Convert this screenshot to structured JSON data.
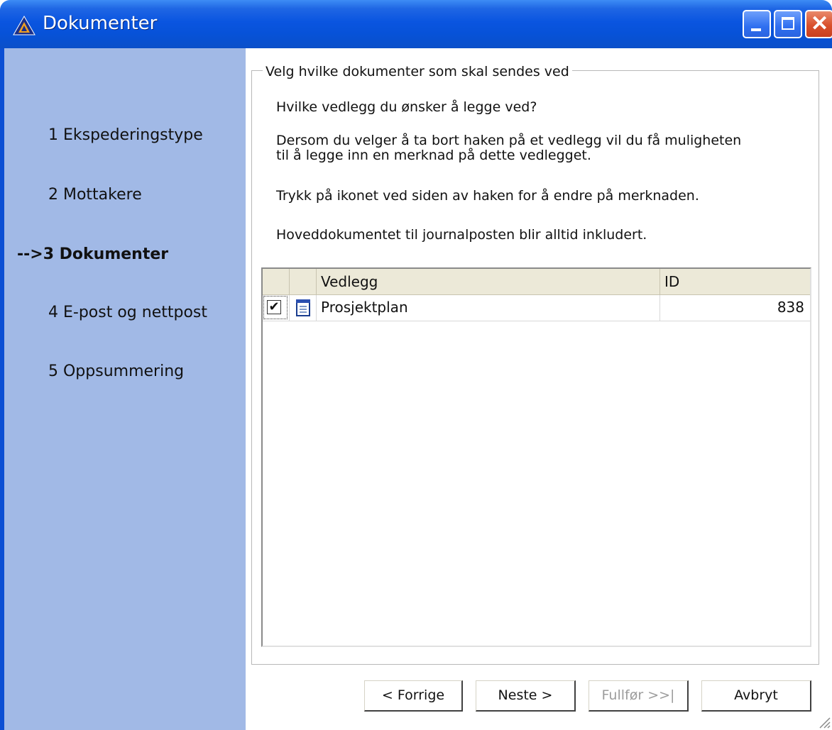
{
  "window": {
    "title": "Dokumenter"
  },
  "steps": [
    {
      "label": "1 Ekspederingstype",
      "active": false
    },
    {
      "label": "2 Mottakere",
      "active": false
    },
    {
      "label": "-->3 Dokumenter",
      "active": true
    },
    {
      "label": "4 E-post og nettpost",
      "active": false
    },
    {
      "label": "5 Oppsummering",
      "active": false
    }
  ],
  "group": {
    "legend": "Velg hvilke dokumenter som skal sendes ved",
    "question": "Hvilke vedlegg du ønsker å legge ved?",
    "info_line1": "Dersom du velger å ta bort haken på et vedlegg vil du få muligheten",
    "info_line2": "til å legge inn en merknad på dette vedlegget.",
    "info_icon": "Trykk på ikonet ved siden av haken for å endre på merknaden.",
    "info_main": "Hoveddokumentet til journalposten blir alltid inkludert."
  },
  "grid": {
    "columns": [
      "Vedlegg",
      "ID"
    ],
    "rows": [
      {
        "checked": true,
        "check_mark": "✔",
        "icon": "document-icon",
        "name": "Prosjektplan",
        "id": "838"
      }
    ]
  },
  "buttons": {
    "back": "< Forrige",
    "next": "Neste >",
    "finish": "Fullfør >>|",
    "cancel": "Avbryt"
  },
  "colors": {
    "titlebar": "#0752d8",
    "sidebar": "#a1b9e6",
    "panel": "#ffffff"
  }
}
